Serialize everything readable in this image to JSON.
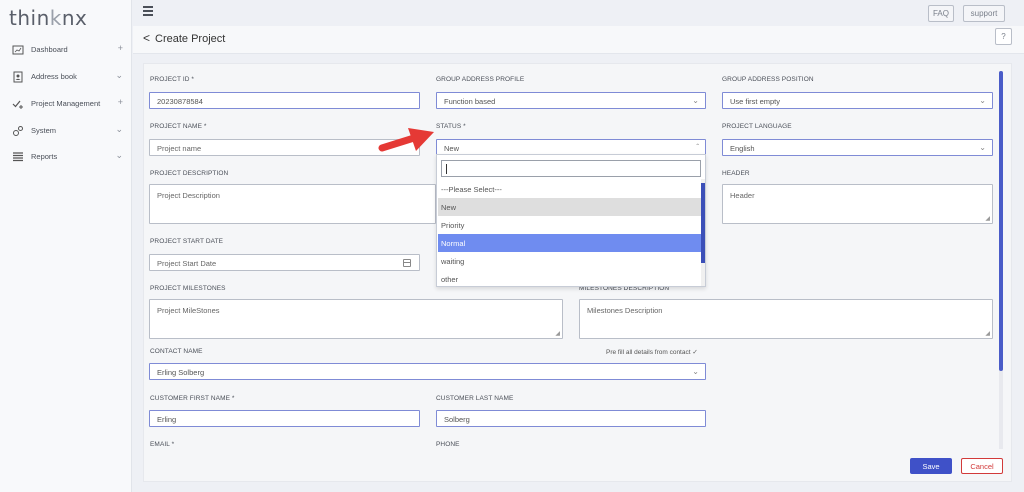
{
  "app": {
    "logo": {
      "part1": "thin",
      "part2": "k",
      "part3": "nx"
    },
    "faq_label": "FAQ",
    "support_label": "support"
  },
  "sidebar": {
    "items": [
      {
        "label": "Dashboard",
        "icon": "dashboard-icon",
        "caret": "+"
      },
      {
        "label": "Address book",
        "icon": "address-book-icon",
        "caret": "⌄"
      },
      {
        "label": "Project Management",
        "icon": "project-management-icon",
        "caret": "+"
      },
      {
        "label": "System",
        "icon": "system-icon",
        "caret": "⌄"
      },
      {
        "label": "Reports",
        "icon": "reports-icon",
        "caret": "⌄"
      }
    ]
  },
  "page": {
    "back_glyph": "<",
    "title": "Create Project",
    "help_label": "?"
  },
  "form": {
    "project_id": {
      "label": "PROJECT ID *",
      "value": "20230878584"
    },
    "group_address_profile": {
      "label": "GROUP ADDRESS PROFILE",
      "value": "Function based"
    },
    "group_address_position": {
      "label": "GROUP ADDRESS POSITION",
      "value": "Use first empty"
    },
    "project_name": {
      "label": "PROJECT NAME *",
      "placeholder": "Project name"
    },
    "status": {
      "label": "STATUS *",
      "value": "New"
    },
    "project_language": {
      "label": "PROJECT LANGUAGE",
      "value": "English"
    },
    "project_description": {
      "label": "PROJECT DESCRIPTION",
      "placeholder": "Project Description"
    },
    "header": {
      "label": "HEADER",
      "placeholder": "Header"
    },
    "project_start_date": {
      "label": "PROJECT START DATE",
      "placeholder": "Project Start Date"
    },
    "project_milestones": {
      "label": "PROJECT MILESTONES",
      "placeholder": "Project MileStones"
    },
    "milestones_description": {
      "label": "MILESTONES DESCRIPTION",
      "placeholder": "Milestones Description"
    },
    "contact_name": {
      "label": "CONTACT NAME",
      "value": "Erling Solberg",
      "prefill": "Pre fill all details from contact ✓"
    },
    "customer_first_name": {
      "label": "CUSTOMER FIRST NAME *",
      "value": "Erling"
    },
    "customer_last_name": {
      "label": "CUSTOMER LAST NAME",
      "value": "Solberg"
    },
    "email": {
      "label": "EMAIL *"
    },
    "phone": {
      "label": "PHONE"
    }
  },
  "status_dropdown": {
    "options": [
      "---Please Select---",
      "New",
      "Priority",
      "Normal",
      "waiting",
      "other"
    ],
    "hovered": "New",
    "selected": "Normal"
  },
  "actions": {
    "save_label": "Save",
    "cancel_label": "Cancel"
  },
  "colors": {
    "accent": "#3f51c8",
    "selected_option": "#6f8cf0",
    "cancel": "#d23a3a",
    "annotation_arrow": "#e53935"
  }
}
